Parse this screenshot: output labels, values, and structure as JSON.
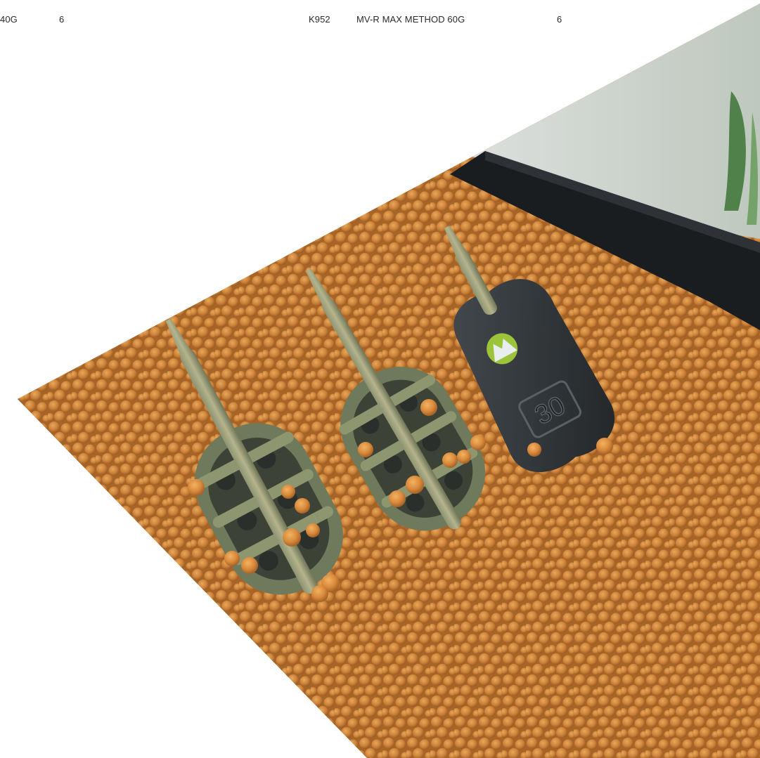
{
  "table_rows": [
    {
      "code": "",
      "weight_fragment": "40G",
      "qty": "6"
    },
    {
      "code": "K952",
      "description": "MV-R MAX METHOD 60G",
      "qty": "6"
    }
  ],
  "product_photo": {
    "subject": "method-feeders-on-pellets",
    "lead_marking": "30",
    "colors": {
      "pellets": "#d98a3c",
      "feeder_frame": "#6f7a5c",
      "lead": "#2f3336",
      "logo_green": "#9bc43a",
      "tray": "#1c1f22"
    }
  }
}
